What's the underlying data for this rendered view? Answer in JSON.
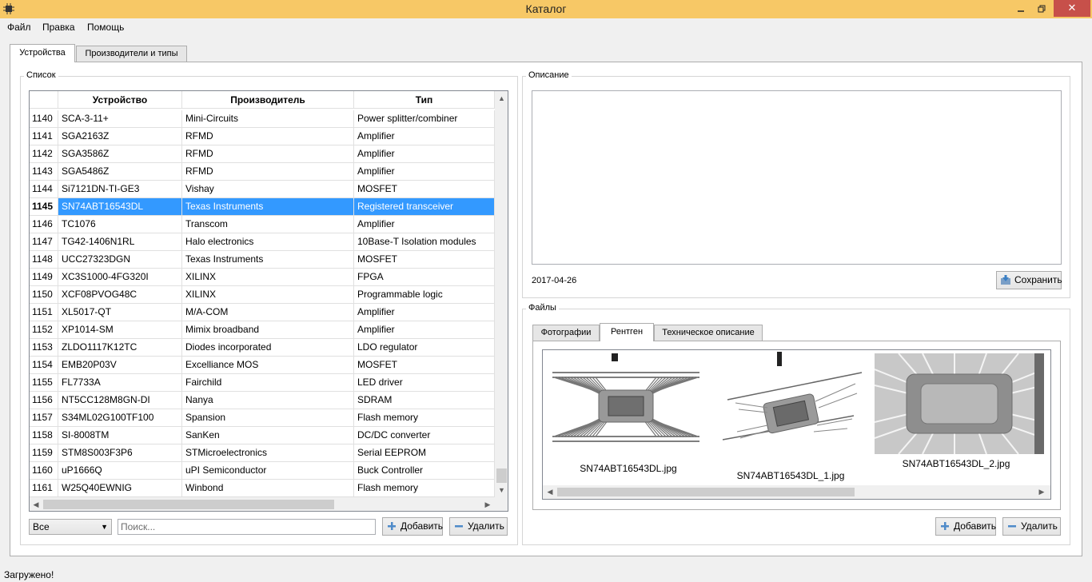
{
  "window": {
    "title": "Каталог",
    "min": "🗕",
    "max": "🗗",
    "close": "✕"
  },
  "menu": [
    "Файл",
    "Правка",
    "Помощь"
  ],
  "tabs": [
    "Устройства",
    "Производители и типы"
  ],
  "list_group": {
    "label": "Список"
  },
  "table": {
    "columns": [
      "Устройство",
      "Производитель",
      "Тип"
    ],
    "rows": [
      [
        "1140",
        "SCA-3-11+",
        "Mini-Circuits",
        "Power splitter/combiner"
      ],
      [
        "1141",
        "SGA2163Z",
        "RFMD",
        "Amplifier"
      ],
      [
        "1142",
        "SGA3586Z",
        "RFMD",
        "Amplifier"
      ],
      [
        "1143",
        "SGA5486Z",
        "RFMD",
        "Amplifier"
      ],
      [
        "1144",
        "Si7121DN-TI-GE3",
        "Vishay",
        "MOSFET"
      ],
      [
        "1145",
        "SN74ABT16543DL",
        "Texas Instruments",
        "Registered transceiver"
      ],
      [
        "1146",
        "TC1076",
        "Transcom",
        "Amplifier"
      ],
      [
        "1147",
        "TG42-1406N1RL",
        "Halo electronics",
        "10Base-T Isolation modules"
      ],
      [
        "1148",
        "UCC27323DGN",
        "Texas Instruments",
        "MOSFET"
      ],
      [
        "1149",
        "XC3S1000-4FG320I",
        "XILINX",
        "FPGA"
      ],
      [
        "1150",
        "XCF08PVOG48C",
        "XILINX",
        "Programmable logic"
      ],
      [
        "1151",
        "XL5017-QT",
        "M/A-COM",
        "Amplifier"
      ],
      [
        "1152",
        "XP1014-SM",
        "Mimix broadband",
        "Amplifier"
      ],
      [
        "1153",
        "ZLDO1117K12TC",
        "Diodes incorporated",
        "LDO regulator"
      ],
      [
        "1154",
        "EMB20P03V",
        "Excelliance MOS",
        "MOSFET"
      ],
      [
        "1155",
        "FL7733A",
        "Fairchild",
        "LED driver"
      ],
      [
        "1156",
        "NT5CC128M8GN-DI",
        "Nanya",
        "SDRAM"
      ],
      [
        "1157",
        "S34ML02G100TF100",
        "Spansion",
        "Flash memory"
      ],
      [
        "1158",
        "SI-8008TM",
        "SanKen",
        "DC/DC converter"
      ],
      [
        "1159",
        "STM8S003F3P6",
        "STMicroelectronics",
        "Serial EEPROM"
      ],
      [
        "1160",
        "uP1666Q",
        "uPI Semiconductor",
        "Buck Controller"
      ],
      [
        "1161",
        "W25Q40EWNIG",
        "Winbond",
        "Flash memory"
      ]
    ],
    "selected_row": "1145"
  },
  "filter": {
    "selected": "Все",
    "search_placeholder": "Поиск..."
  },
  "list_buttons": {
    "add": "Добавить",
    "delete": "Удалить"
  },
  "description_group": {
    "label": "Описание",
    "text": "",
    "date": "2017-04-26",
    "save": "Сохранить"
  },
  "files_group": {
    "label": "Файлы",
    "tabs": [
      "Фотографии",
      "Рентген",
      "Техническое описание"
    ],
    "active_tab": "Рентген",
    "files": [
      "SN74ABT16543DL.jpg",
      "SN74ABT16543DL_1.jpg",
      "SN74ABT16543DL_2.jpg"
    ],
    "add": "Добавить",
    "delete": "Удалить"
  },
  "status": "Загружено!",
  "colors": {
    "titlebar": "#f7c866",
    "close": "#c7504a",
    "selection": "#3399ff"
  }
}
